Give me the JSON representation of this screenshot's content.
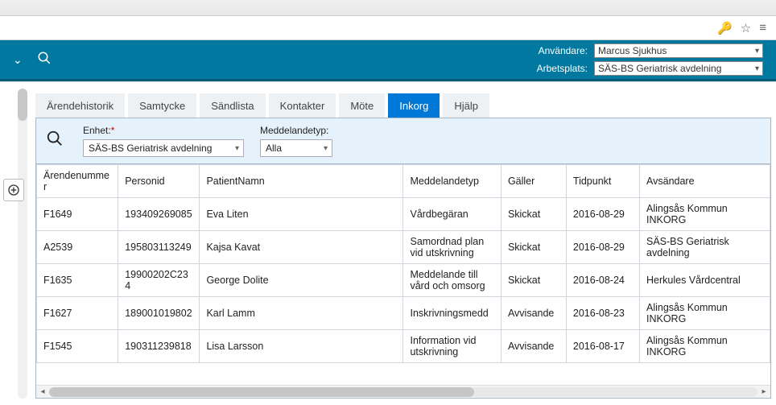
{
  "browser_icons": {
    "key": "🔑",
    "star": "☆",
    "menu": "≡"
  },
  "header": {
    "user_label": "Användare:",
    "user_value": "Marcus Sjukhus",
    "workplace_label": "Arbetsplats:",
    "workplace_value": "SÄS-BS Geriatrisk avdelning"
  },
  "tabs": {
    "t0": "Ärendehistorik",
    "t1": "Samtycke",
    "t2": "Sändlista",
    "t3": "Kontakter",
    "t4": "Möte",
    "t5": "Inkorg",
    "t6": "Hjälp"
  },
  "filters": {
    "unit_label": "Enhet:",
    "unit_value": "SÄS-BS Geriatrisk avdelning",
    "msgtype_label": "Meddelandetyp:",
    "msgtype_value": "Alla"
  },
  "columns": {
    "c0": "Ärendenummer",
    "c1": "Personid",
    "c2": "PatientNamn",
    "c3": "Meddelandetyp",
    "c4": "Gäller",
    "c5": "Tidpunkt",
    "c6": "Avsändare"
  },
  "rows": [
    {
      "c0": "F1649",
      "c1": "193409269085",
      "c2": "Eva Liten",
      "c3": "Vårdbegäran",
      "c4": "Skickat",
      "c5": "2016-08-29",
      "c6": "Alingsås Kommun INKORG"
    },
    {
      "c0": "A2539",
      "c1": "195803113249",
      "c2": "Kajsa Kavat",
      "c3": "Samordnad plan vid utskrivning",
      "c4": "Skickat",
      "c5": "2016-08-29",
      "c6": "SÄS-BS Geriatrisk avdelning"
    },
    {
      "c0": "F1635",
      "c1": "19900202C234",
      "c2": "George Dolite",
      "c3": "Meddelande till vård och omsorg",
      "c4": "Skickat",
      "c5": "2016-08-24",
      "c6": "Herkules Vårdcentral"
    },
    {
      "c0": "F1627",
      "c1": "189001019802",
      "c2": "Karl Lamm",
      "c3": "Inskrivningsmedd",
      "c4": "Avvisande",
      "c5": "2016-08-23",
      "c6": "Alingsås Kommun INKORG"
    },
    {
      "c0": "F1545",
      "c1": "190311239818",
      "c2": "Lisa Larsson",
      "c3": "Information vid utskrivning",
      "c4": "Avvisande",
      "c5": "2016-08-17",
      "c6": "Alingsås Kommun INKORG"
    }
  ]
}
